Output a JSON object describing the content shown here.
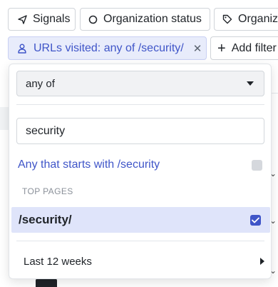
{
  "filter_bar": {
    "chips": [
      {
        "label": "Signals",
        "icon": "signal-arrow-icon"
      },
      {
        "label": "Organization status",
        "icon": "circle-icon"
      },
      {
        "label": "Organiza",
        "icon": "tag-icon"
      }
    ],
    "active_filter": {
      "label": "URLs visited: any of /security/",
      "icon": "person-icon",
      "remove_icon": "close-icon"
    },
    "add_filter_label": "Add filter"
  },
  "dropdown": {
    "operator_value": "any of",
    "search_value": "security",
    "search_placeholder": "",
    "starts_with_option": "Any that starts with /security",
    "section_title": "TOP PAGES",
    "top_pages": [
      {
        "label": "/security/",
        "checked": true
      }
    ],
    "date_range_label": "Last 12 weeks"
  },
  "colors": {
    "accent": "#3f55c8",
    "chip_active_bg": "#e8ecfb",
    "selected_row_bg": "#dfe4fa"
  }
}
